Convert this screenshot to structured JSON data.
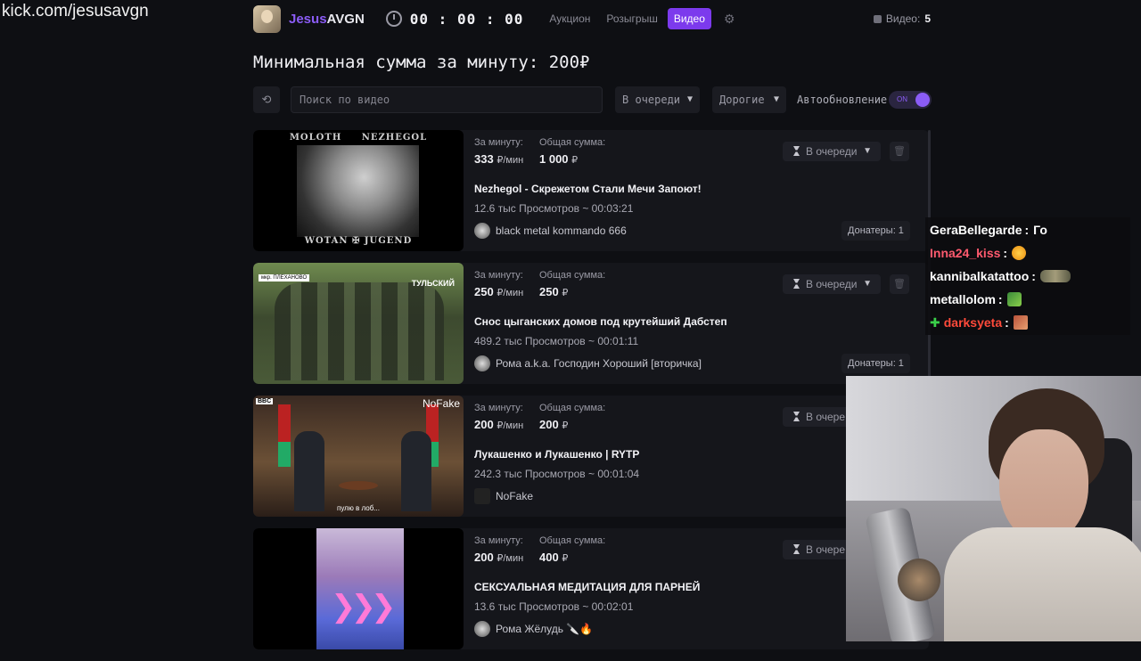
{
  "watermark": "kick.com/jesusavgn",
  "header": {
    "brand_a": "Jesus",
    "brand_b": "AVGN",
    "timer": "00 : 00 : 00",
    "tabs": [
      "Аукцион",
      "Розыгрыш",
      "Видео"
    ],
    "active_tab": "Видео",
    "video_count_label": "Видео:",
    "video_count": "5"
  },
  "min_title": "Минимальная сумма за минуту: 200₽",
  "toolbar": {
    "search_placeholder": "Поиск по видео",
    "queue_select": "В очереди",
    "price_select": "Дорогие",
    "auto_label": "Автообновление",
    "toggle_on": "ON"
  },
  "labels": {
    "per_minute": "За минуту:",
    "total": "Общая сумма:",
    "per_min_unit": "₽/мин",
    "currency": "₽"
  },
  "videos": [
    {
      "per_minute": "333",
      "total": "1 000",
      "title": "Nezhegol - Скрежетом Стали Мечи Запоют!",
      "meta": "12.6 тыс Просмотров ~ 00:03:21",
      "author": "black metal kommando 666",
      "status": "В очереди",
      "donors": "Донатеры: 1",
      "thumb_top_left": "MOLOTH",
      "thumb_top_right": "NEZHEGOL",
      "thumb_bottom": "WOTAN ✠ JUGEND"
    },
    {
      "per_minute": "250",
      "total": "250",
      "title": "Снос цыганских домов под крутейший Дабстеп",
      "meta": "489.2 тыс Просмотров ~ 00:01:11",
      "author": "Рома a.k.a. Господин Хороший [вторичка]",
      "status": "В очереди",
      "donors": "Донатеры: 1",
      "thumb_logo": "ТУЛЬСКИЙ",
      "thumb_tag": "мкр. ПЛЕХАНОВО"
    },
    {
      "per_minute": "200",
      "total": "200",
      "title": "Лукашенко и Лукашенко | RYTP",
      "meta": "242.3 тыс Просмотров ~ 00:01:04",
      "author": "NoFake",
      "status": "В очере",
      "thumb_logo": "NoFake",
      "thumb_bbc": "BBC",
      "thumb_sub": "пулю в лоб..."
    },
    {
      "per_minute": "200",
      "total": "400",
      "title": "СЕКСУАЛЬНАЯ МЕДИТАЦИЯ ДЛЯ ПАРНЕЙ",
      "meta": "13.6 тыс Просмотров ~ 00:02:01",
      "author": "Рома Жёлудь 🔪🔥",
      "status": "В очере"
    }
  ],
  "chat": [
    {
      "user": "GeraBellegarde",
      "color": "#ffffff",
      "text": "Го"
    },
    {
      "user": "Inna24_kiss",
      "color": "#ff5a6e",
      "emote": "emote-face"
    },
    {
      "user": "kannibalkatattoo",
      "color": "#ffffff",
      "emote": "emote-wide"
    },
    {
      "user": "metallolom",
      "color": "#ffffff",
      "emote": "emote-pepe"
    },
    {
      "user": "darksyeta",
      "color": "#ff4a3a",
      "emote": "emote-img",
      "badge": "✚"
    }
  ],
  "chat_separator": ":"
}
